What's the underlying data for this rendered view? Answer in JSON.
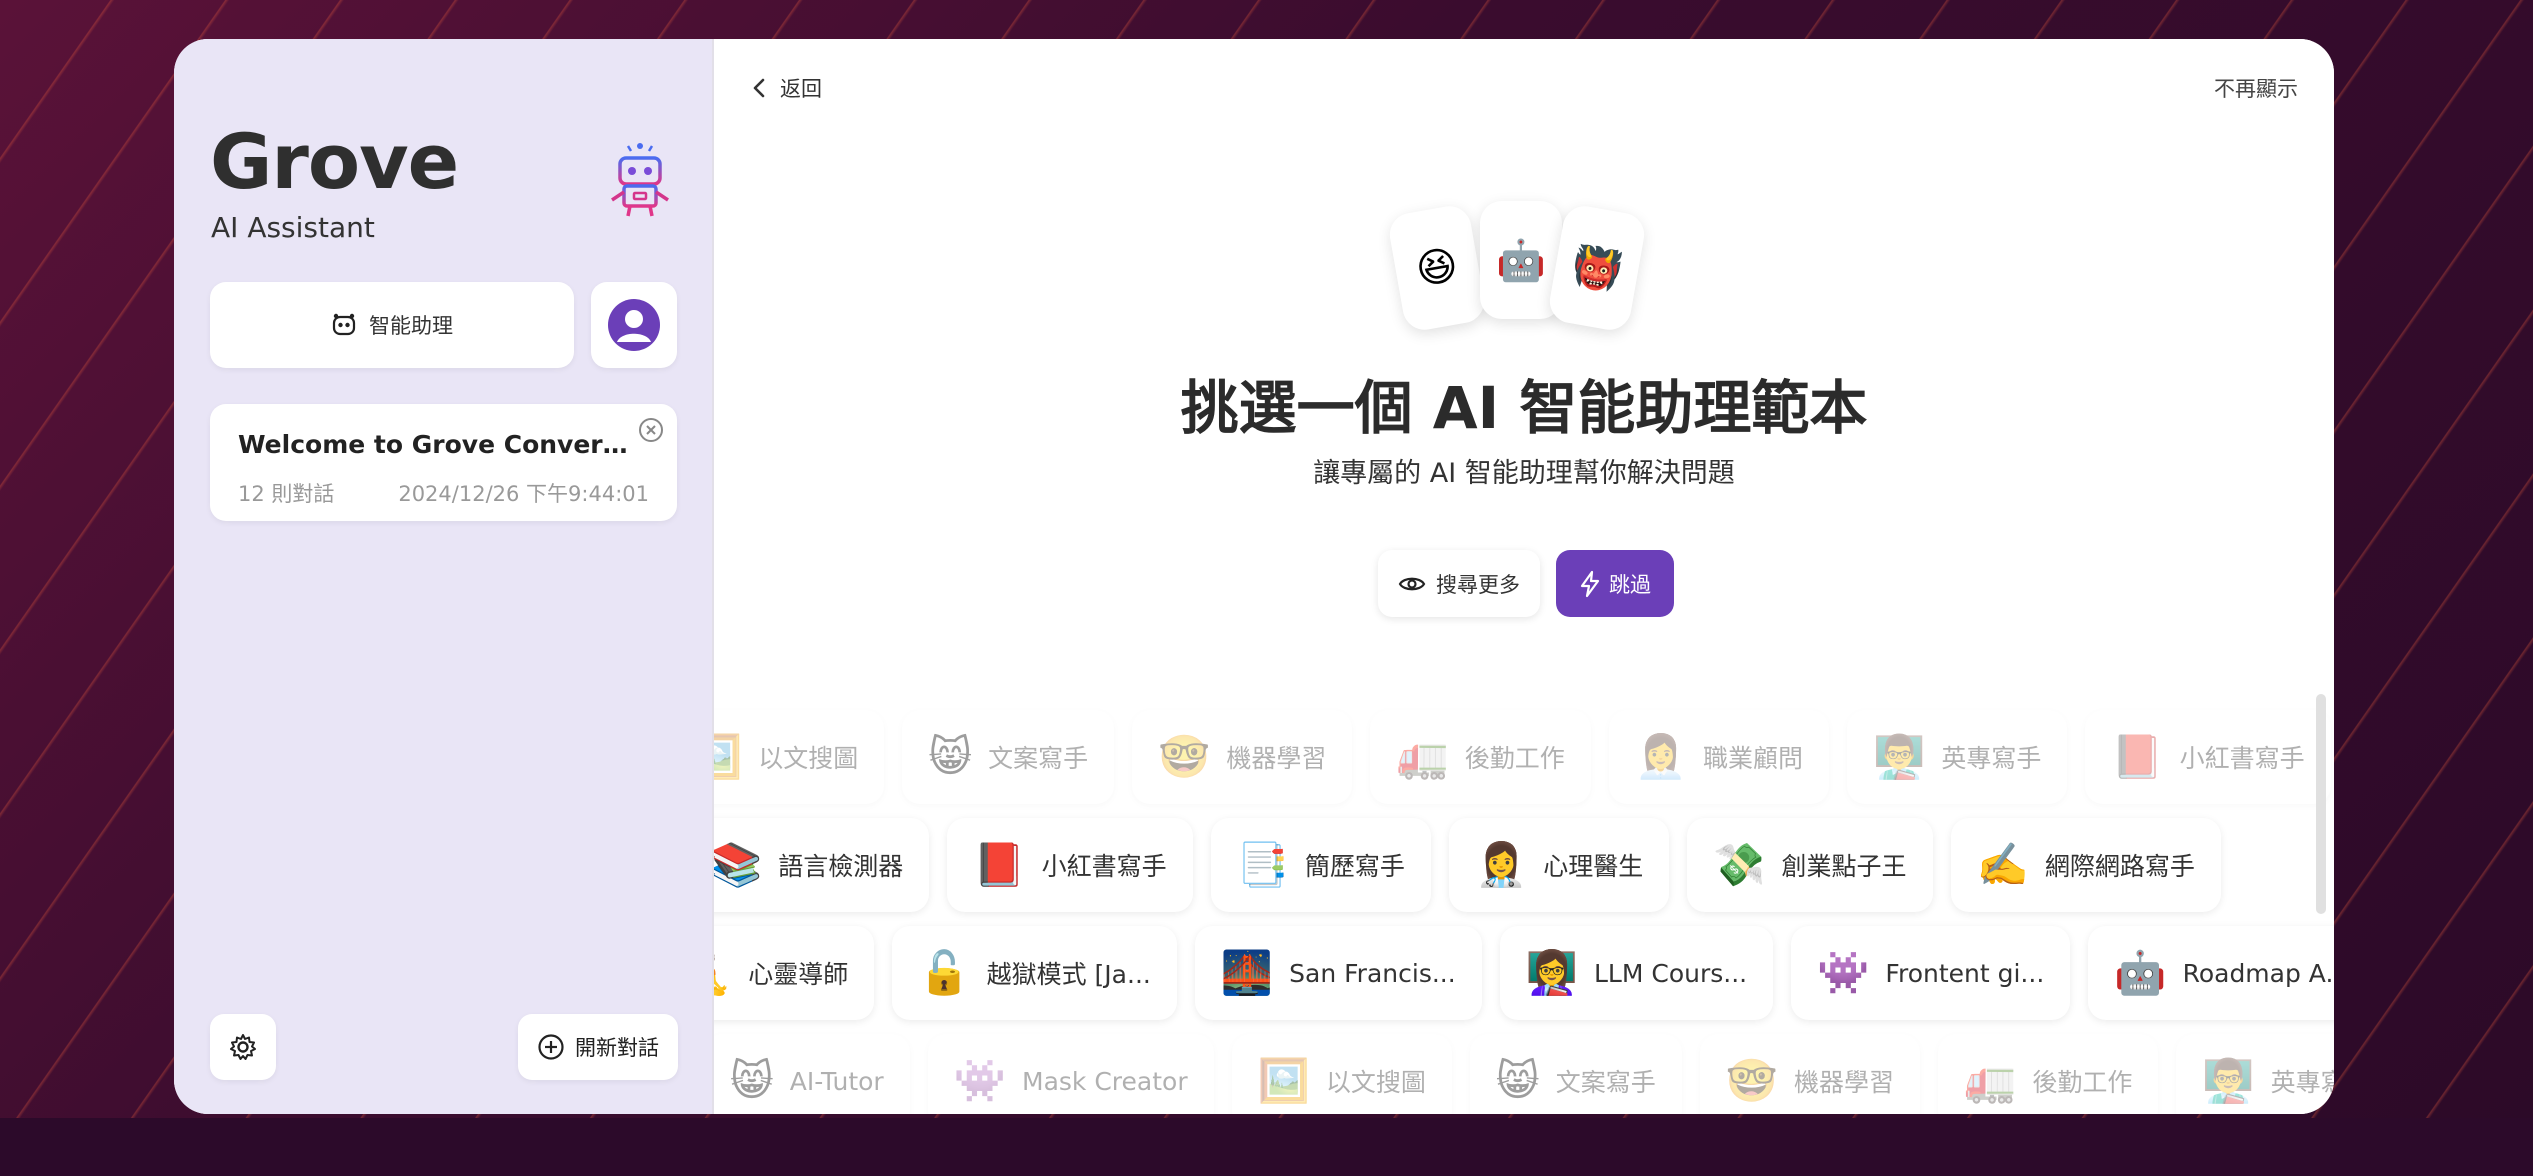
{
  "brand": {
    "title": "Grove",
    "subtitle": "AI Assistant",
    "logo_icon": "robot-icon"
  },
  "sidebar": {
    "assistant_button_label": "智能助理",
    "chat": {
      "title": "Welcome to Grove Conversat...",
      "count": "12 則對話",
      "date": "2024/12/26 下午9:44:01"
    },
    "new_chat_label": "開新對話"
  },
  "main": {
    "back_label": "返回",
    "dismiss_label": "不再顯示",
    "emojis": [
      "😆",
      "🤖",
      "👹"
    ],
    "headline": "挑選一個 AI 智能助理範本",
    "subheadline": "讓專屬的 AI 智能助理幫你解決問題",
    "search_more_label": "搜尋更多",
    "skip_label": "跳過"
  },
  "mask_rows": [
    [
      {
        "icon": "🖼️",
        "label": "以文搜圖"
      },
      {
        "icon": "😸",
        "label": "文案寫手"
      },
      {
        "icon": "🤓",
        "label": "機器學習"
      },
      {
        "icon": "🚛",
        "label": "後勤工作"
      },
      {
        "icon": "👩‍💼",
        "label": "職業顧問"
      },
      {
        "icon": "👨‍🏫",
        "label": "英專寫手"
      },
      {
        "icon": "📕",
        "label": "小紅書寫手"
      }
    ],
    [
      {
        "icon": "📚",
        "label": "語言檢測器"
      },
      {
        "icon": "📕",
        "label": "小紅書寫手"
      },
      {
        "icon": "📑",
        "label": "簡歷寫手"
      },
      {
        "icon": "👩‍⚕️",
        "label": "心理醫生"
      },
      {
        "icon": "💸",
        "label": "創業點子王"
      },
      {
        "icon": "✍️",
        "label": "網際網路寫手"
      }
    ],
    [
      {
        "icon": "🧘",
        "label": "心靈導師"
      },
      {
        "icon": "🔓",
        "label": "越獄模式 [Ja..."
      },
      {
        "icon": "🌉",
        "label": "San Francis..."
      },
      {
        "icon": "👩‍🏫",
        "label": "LLM Cours..."
      },
      {
        "icon": "👾",
        "label": "Frontent gi..."
      },
      {
        "icon": "🤖",
        "label": "Roadmap A..."
      }
    ],
    [
      {
        "icon": "😸",
        "label": "AI-Tutor"
      },
      {
        "icon": "👾",
        "label": "Mask Creator"
      },
      {
        "icon": "🖼️",
        "label": "以文搜圖"
      },
      {
        "icon": "😸",
        "label": "文案寫手"
      },
      {
        "icon": "🤓",
        "label": "機器學習"
      },
      {
        "icon": "🚛",
        "label": "後勤工作"
      },
      {
        "icon": "👨‍🏫",
        "label": "英專寫手"
      }
    ]
  ],
  "colors": {
    "accent": "#6b3fb8",
    "sidebar_bg": "#e9e5f6"
  }
}
